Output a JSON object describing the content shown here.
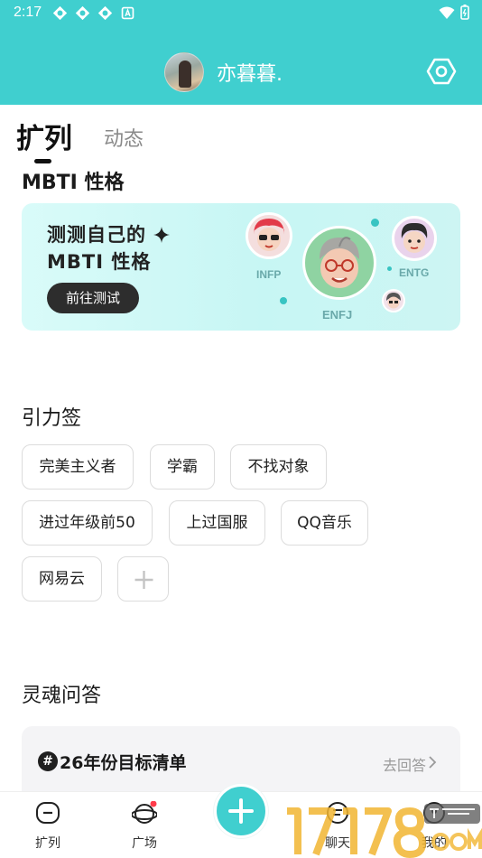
{
  "status_bar": {
    "time": "2:17"
  },
  "header": {
    "username": "亦暮暮."
  },
  "tabs": [
    {
      "label": "扩列"
    },
    {
      "label": "动态"
    }
  ],
  "mbti": {
    "section_title": "MBTI 性格",
    "banner_line1": "测测自己的",
    "banner_line2": "MBTI 性格",
    "button_label": "前往测试",
    "types": [
      {
        "label": "INFP"
      },
      {
        "label": "ENFJ"
      },
      {
        "label": "ENTG"
      }
    ]
  },
  "tags": {
    "section_title": "引力签",
    "items": [
      {
        "label": "完美主义者"
      },
      {
        "label": "学霸"
      },
      {
        "label": "不找对象"
      },
      {
        "label": "进过年级前50"
      },
      {
        "label": "上过国服"
      },
      {
        "label": "QQ音乐"
      },
      {
        "label": "网易云"
      }
    ]
  },
  "qa": {
    "section_title": "灵魂问答",
    "card_title": "26年份目标清单",
    "action_label": "去回答"
  },
  "bottom_nav": {
    "items": [
      {
        "label": "扩列"
      },
      {
        "label": "广场"
      },
      {
        "label": "聊天"
      },
      {
        "label": "我的"
      }
    ]
  },
  "colors": {
    "accent": "#40cfcf",
    "badge": "#ff3b4a"
  }
}
